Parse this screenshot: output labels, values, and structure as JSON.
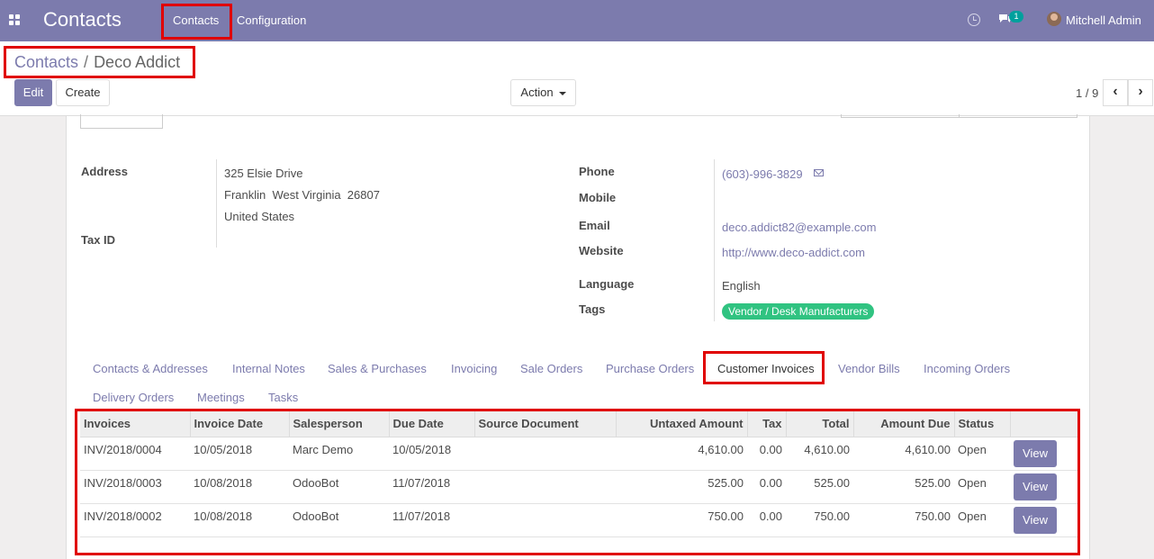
{
  "navbar": {
    "app_title": "Contacts",
    "menu": [
      "Contacts",
      "Configuration"
    ],
    "chat_badge": "1",
    "user": "Mitchell Admin",
    "icons": [
      "apps-icon",
      "clock-icon",
      "chat-icon",
      "avatar"
    ]
  },
  "breadcrumb": {
    "parent": "Contacts",
    "separator": "/",
    "current": "Deco Addict"
  },
  "buttons": {
    "edit": "Edit",
    "create": "Create",
    "action": "Action"
  },
  "pager": {
    "value": "1 / 9",
    "prev": "‹",
    "next": "›"
  },
  "form": {
    "address_label": "Address",
    "street": "325 Elsie Drive",
    "city_line": "Franklin  West Virginia  26807",
    "country": "United States",
    "taxid_label": "Tax ID",
    "phone_label": "Phone",
    "phone": "(603)-996-3829",
    "mobile_label": "Mobile",
    "email_label": "Email",
    "email": "deco.addict82@example.com",
    "website_label": "Website",
    "website": "http://www.deco-addict.com",
    "language_label": "Language",
    "language": "English",
    "tags_label": "Tags",
    "tag": "Vendor / Desk Manufacturers"
  },
  "tabs": [
    "Contacts & Addresses",
    "Internal Notes",
    "Sales & Purchases",
    "Invoicing",
    "Sale Orders",
    "Purchase Orders",
    "Customer Invoices",
    "Vendor Bills",
    "Incoming Orders",
    "Delivery Orders",
    "Meetings",
    "Tasks"
  ],
  "active_tab": "Customer Invoices",
  "invoices": {
    "headers": [
      "Invoices",
      "Invoice Date",
      "Salesperson",
      "Due Date",
      "Source Document",
      "Untaxed Amount",
      "Tax",
      "Total",
      "Amount Due",
      "Status",
      ""
    ],
    "rows": [
      {
        "number": "INV/2018/0004",
        "date": "10/05/2018",
        "salesperson": "Marc Demo",
        "due": "10/05/2018",
        "source": "",
        "untaxed": "4,610.00",
        "tax": "0.00",
        "total": "4,610.00",
        "amount_due": "4,610.00",
        "status": "Open",
        "action": "View"
      },
      {
        "number": "INV/2018/0003",
        "date": "10/08/2018",
        "salesperson": "OdooBot",
        "due": "11/07/2018",
        "source": "",
        "untaxed": "525.00",
        "tax": "0.00",
        "total": "525.00",
        "amount_due": "525.00",
        "status": "Open",
        "action": "View"
      },
      {
        "number": "INV/2018/0002",
        "date": "10/08/2018",
        "salesperson": "OdooBot",
        "due": "11/07/2018",
        "source": "",
        "untaxed": "750.00",
        "tax": "0.00",
        "total": "750.00",
        "amount_due": "750.00",
        "status": "Open",
        "action": "View"
      }
    ]
  },
  "colors": {
    "brand": "#7c7bad",
    "tag": "#30c381",
    "highlight": "#e00000"
  }
}
